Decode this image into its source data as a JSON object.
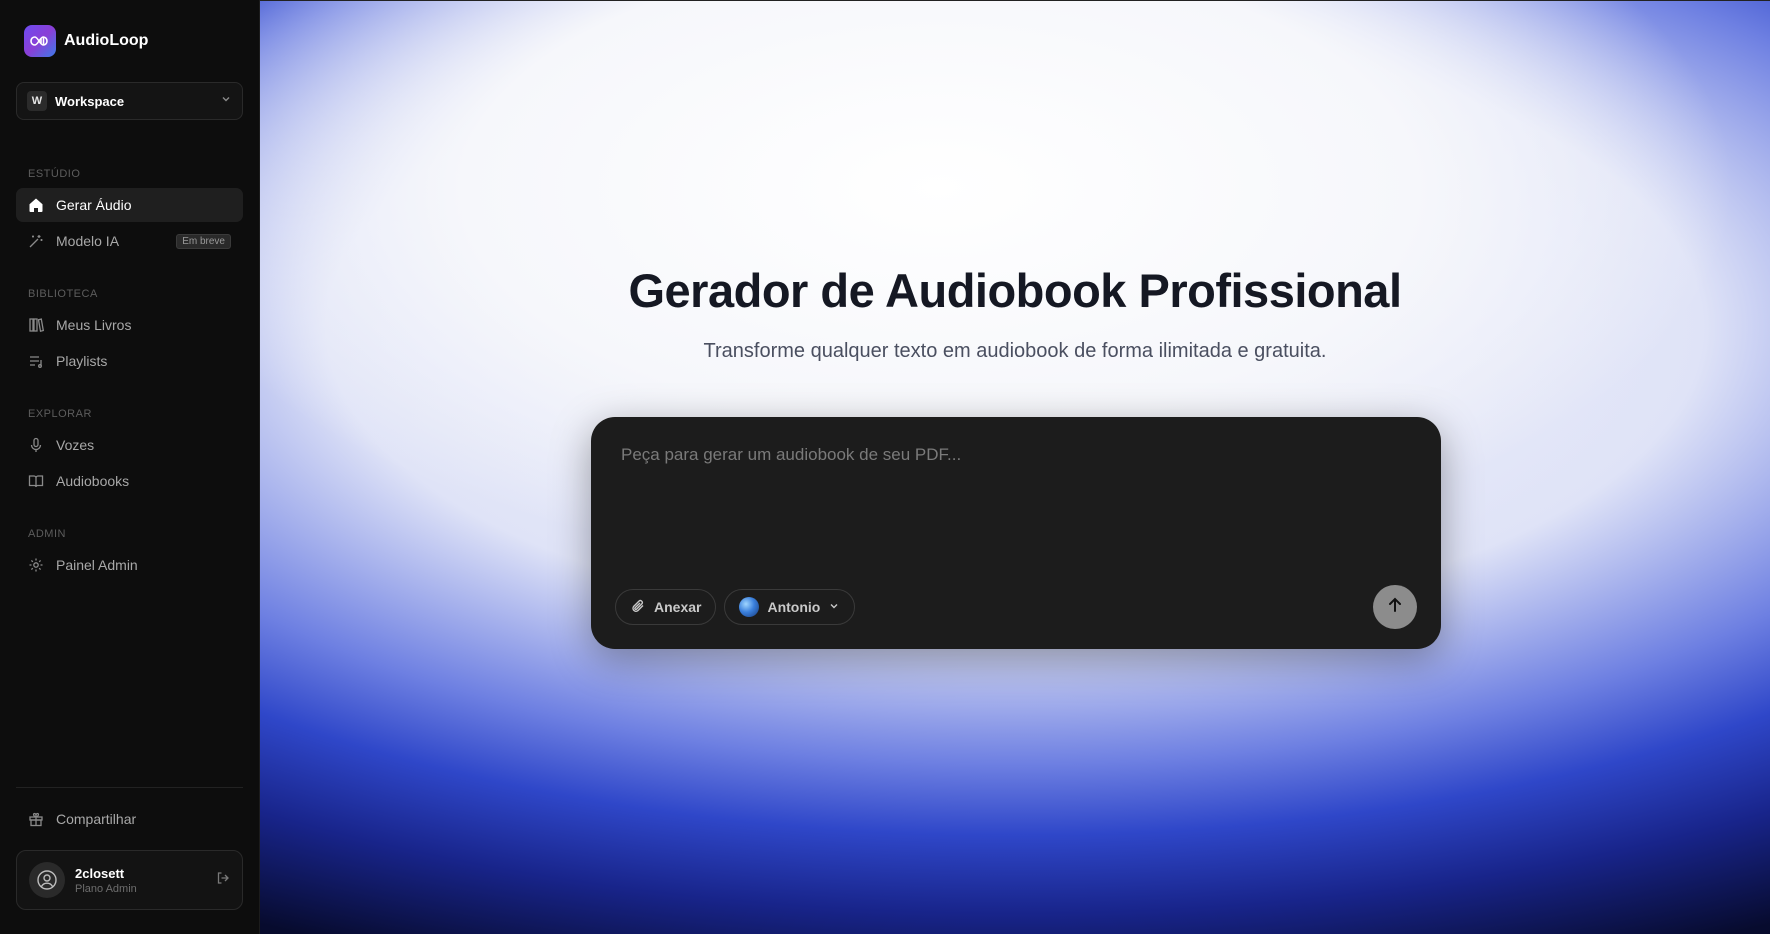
{
  "brand": {
    "name": "AudioLoop"
  },
  "workspace": {
    "badge": "W",
    "label": "Workspace"
  },
  "sidebar": {
    "sections": [
      {
        "label": "ESTÚDIO"
      },
      {
        "label": "BIBLIOTECA"
      },
      {
        "label": "EXPLORAR"
      },
      {
        "label": "ADMIN"
      }
    ],
    "items": {
      "gerar_audio": {
        "label": "Gerar Áudio",
        "icon": "home-icon",
        "active": true
      },
      "modelo_ia": {
        "label": "Modelo IA",
        "icon": "magic-wand-icon",
        "badge": "Em breve"
      },
      "meus_livros": {
        "label": "Meus Livros",
        "icon": "library-icon"
      },
      "playlists": {
        "label": "Playlists",
        "icon": "playlist-icon"
      },
      "vozes": {
        "label": "Vozes",
        "icon": "microphone-icon"
      },
      "audiobooks": {
        "label": "Audiobooks",
        "icon": "book-open-icon"
      },
      "painel_admin": {
        "label": "Painel Admin",
        "icon": "gear-icon"
      }
    },
    "share": {
      "label": "Compartilhar",
      "icon": "gift-icon"
    },
    "user": {
      "name": "2closett",
      "plan": "Plano Admin"
    }
  },
  "hero": {
    "title": "Gerador de Audiobook Profissional",
    "subtitle": "Transforme qualquer texto em audiobook de forma ilimitada e gratuita."
  },
  "composer": {
    "placeholder": "Peça para gerar um audiobook de seu PDF...",
    "value": "",
    "attach_label": "Anexar",
    "voice_label": "Antonio"
  },
  "colors": {
    "accent_blue": "#2f47c9",
    "sidebar_bg": "#0d0d0d",
    "composer_bg": "#1c1c1c"
  }
}
